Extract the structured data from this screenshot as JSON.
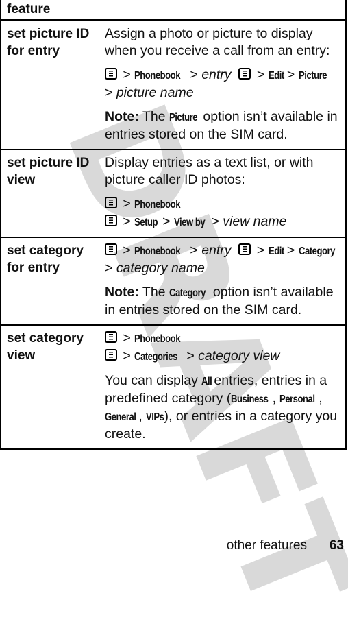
{
  "watermark": "DRAFT",
  "table": {
    "header": "feature",
    "rows": [
      {
        "feature": "set picture ID for entry",
        "feature_line1": "set picture ID",
        "feature_line2": "for entry",
        "intro": "Assign a photo or picture to display when you receive a call from an entry:",
        "path": {
          "menu_icon": "menu-key-icon",
          "sep": ">",
          "steps": [
            "Phonebook",
            "entry",
            "Edit",
            "Picture",
            "picture name"
          ]
        },
        "note_label": "Note:",
        "note_pre": "The",
        "note_cmd": "Picture",
        "note_post": "option isn’t available in entries stored on the SIM card."
      },
      {
        "feature": "set picture ID view",
        "feature_line1": "set picture ID",
        "feature_line2": "view",
        "intro": "Display entries as a text list, or with picture caller ID photos:",
        "path1": [
          "Phonebook"
        ],
        "path2": [
          "Setup",
          "View by",
          "view name"
        ]
      },
      {
        "feature": "set category for entry",
        "feature_line1": "set category",
        "feature_line2": "for entry",
        "path": [
          "Phonebook",
          "entry",
          "Edit",
          "Category",
          "category name"
        ],
        "note_label": "Note:",
        "note_pre": "The",
        "note_cmd": "Category",
        "note_post": "option isn’t available in entries stored on the SIM card."
      },
      {
        "feature": "set category view",
        "feature_line1": "set category",
        "feature_line2": "view",
        "path1": [
          "Phonebook"
        ],
        "path2": [
          "Categories",
          "category view"
        ],
        "body_pre": "You can display",
        "body_all": "All",
        "body_mid": "entries, entries in a predefined category (",
        "categories": [
          "Business",
          "Personal",
          "General",
          "VIPs"
        ],
        "body_post": "), or entries in a category you create."
      }
    ]
  },
  "footer": {
    "section": "other features",
    "page": "63"
  }
}
